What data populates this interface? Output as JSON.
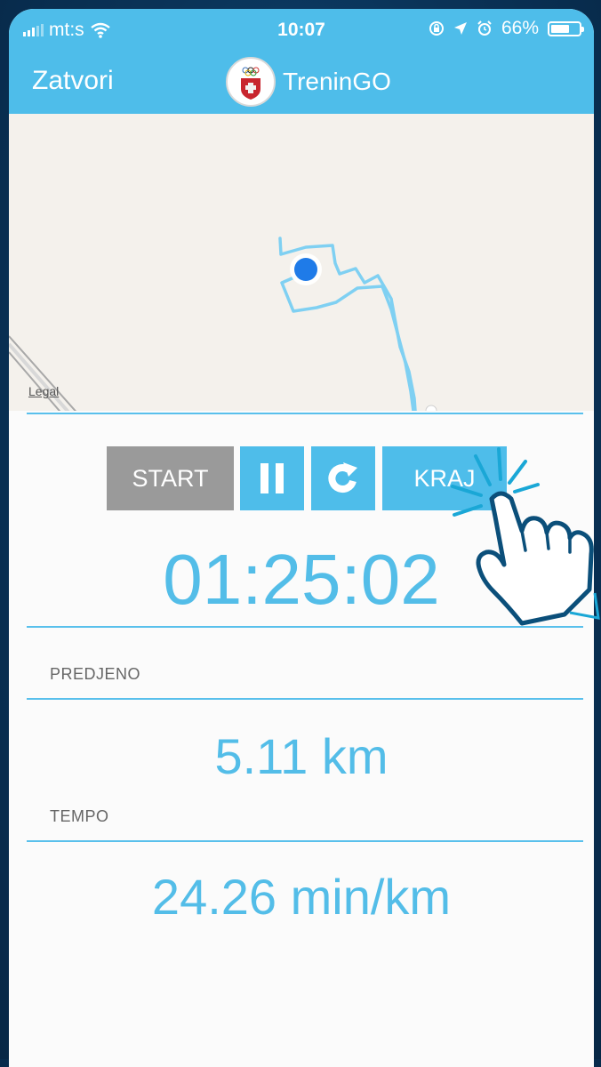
{
  "status_bar": {
    "carrier": "mt:s",
    "time": "10:07",
    "battery": "66%",
    "battery_level": 0.66
  },
  "header": {
    "close_label": "Zatvori",
    "app_name": "TreninGO"
  },
  "map": {
    "legal_label": "Legal"
  },
  "controls": {
    "start_label": "START",
    "pause_icon": "pause-icon",
    "reset_icon": "refresh-icon",
    "end_label": "KRAJ"
  },
  "workout": {
    "elapsed_time": "01:25:02",
    "distance_label": "PREDJENO",
    "distance_value": "5.11 km",
    "pace_label": "TEMPO",
    "pace_value": "24.26 min/km"
  },
  "colors": {
    "accent": "#4ebdea",
    "value_text": "#53bde8",
    "start_button": "#9a9a9a",
    "background": "#0a3358"
  }
}
